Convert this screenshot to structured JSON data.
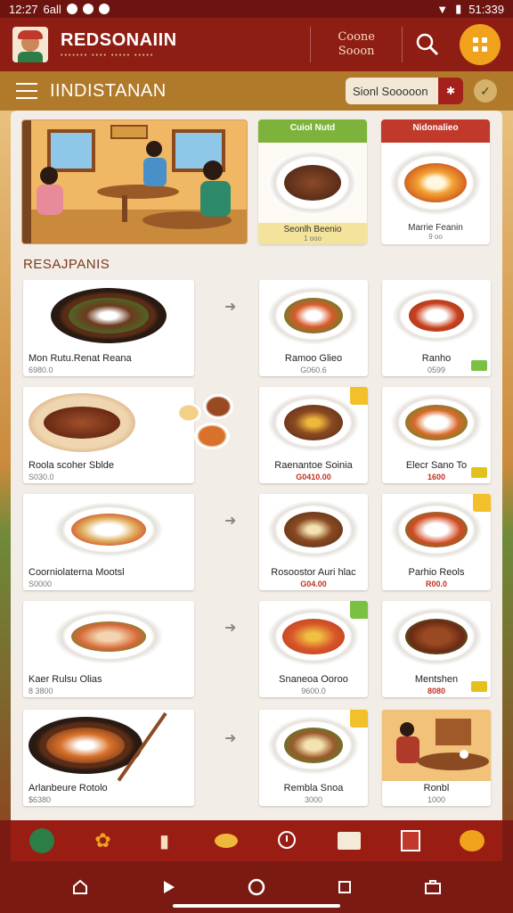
{
  "status": {
    "time": "12:27",
    "carrier": "6all",
    "battery": "51:339"
  },
  "header": {
    "brand": "REDSONAIIN",
    "tagline": "••••••• •••• ••••• •••••",
    "subtitle_line1": "Coone",
    "subtitle_line2": "Sooon"
  },
  "nav": {
    "title": "IINDISTANAN",
    "search_value": "Sionl Sooooon"
  },
  "featured": [
    {
      "head": "Cuiol Nutd",
      "name": "Seonlh Beenio",
      "price": "1 ooo",
      "head_color": "#7db33a"
    },
    {
      "head": "Nidonalieo",
      "name": "Marrie Feanin",
      "price": "9 oo",
      "head_color": "#c0392b"
    }
  ],
  "section_title": "RESAJPANIS",
  "dishes": [
    {
      "name": "Mon Rutu.Renat Reana",
      "price": "6980.0"
    },
    {
      "name": "Ramoo Glieo",
      "price": "G060.6"
    },
    {
      "name": "Ranho",
      "price": "0599"
    },
    {
      "name": "Roola scoher Sblde",
      "price": "S030.0"
    },
    {
      "name": "Raenantoe Soinia",
      "price": "G0410.00"
    },
    {
      "name": "Elecr Sano To",
      "price": "1600"
    },
    {
      "name": "Coorniolaterna Mootsl",
      "price": "S0000"
    },
    {
      "name": "Rosoostor Auri hlac",
      "price": "G04.00"
    },
    {
      "name": "Parhio Reols",
      "price": "R00.0"
    },
    {
      "name": "Kaer Rulsu Olias",
      "price": "8 3800"
    },
    {
      "name": "Snaneoa Ooroo",
      "price": "9600.0"
    },
    {
      "name": "Mentshen",
      "price": "8080"
    },
    {
      "name": "Arlanbeure Rotolo",
      "price": "$6380"
    },
    {
      "name": "Rembla Snoa",
      "price": "3000"
    },
    {
      "name": "Ronbl",
      "price": "1000"
    }
  ],
  "icons": {
    "search": "search-icon",
    "menu": "grid-menu-icon",
    "hamburger": "hamburger-icon",
    "arrow": "arrow-right-icon"
  },
  "colors": {
    "header": "#8e1d14",
    "nav": "#b07a2a",
    "accent": "#f0a21c",
    "panel": "#f2ede6"
  }
}
